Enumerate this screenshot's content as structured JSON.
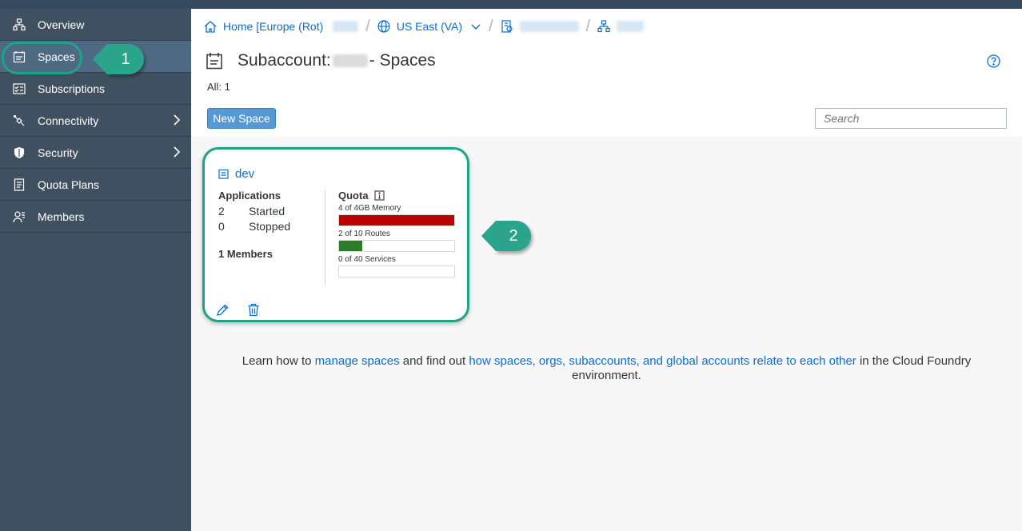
{
  "sidebar": {
    "items": [
      {
        "label": "Overview",
        "icon": "hierarchy-icon"
      },
      {
        "label": "Spaces",
        "icon": "space-icon",
        "active": true
      },
      {
        "label": "Subscriptions",
        "icon": "checklist-icon"
      },
      {
        "label": "Connectivity",
        "icon": "connectivity-icon",
        "has_submenu": true
      },
      {
        "label": "Security",
        "icon": "shield-icon",
        "has_submenu": true
      },
      {
        "label": "Quota Plans",
        "icon": "quota-icon"
      },
      {
        "label": "Members",
        "icon": "members-icon"
      }
    ]
  },
  "callouts": {
    "first": "1",
    "second": "2"
  },
  "breadcrumb": {
    "home": "Home [Europe (Rot)",
    "region": "US East (VA)"
  },
  "page": {
    "title_prefix": "Subaccount:",
    "title_suffix": "- Spaces",
    "count": "All: 1",
    "new_space_label": "New Space",
    "search_placeholder": "Search"
  },
  "space_card": {
    "name": "dev",
    "applications_heading": "Applications",
    "started_count": "2",
    "started_label": "Started",
    "stopped_count": "0",
    "stopped_label": "Stopped",
    "members_label": "1 Members",
    "quota_heading": "Quota",
    "quotas": [
      {
        "label": "4 of 4GB Memory",
        "used": 4,
        "total": 4,
        "color": "#bb0000"
      },
      {
        "label": "2 of 10 Routes",
        "used": 2,
        "total": 10,
        "color": "#2b7d2b"
      },
      {
        "label": "0 of 40 Services",
        "used": 0,
        "total": 40,
        "color": "#2b7d2b"
      }
    ]
  },
  "learn": {
    "prefix": "Learn how to",
    "link1": "manage spaces",
    "middle": "and find out",
    "link2": "how spaces, orgs, subaccounts, and global accounts relate to each other",
    "suffix": "in the Cloud Foundry environment."
  },
  "colors": {
    "accent": "#0a6ed1",
    "sidebar": "#3f5161",
    "callout": "#2aa58b"
  }
}
